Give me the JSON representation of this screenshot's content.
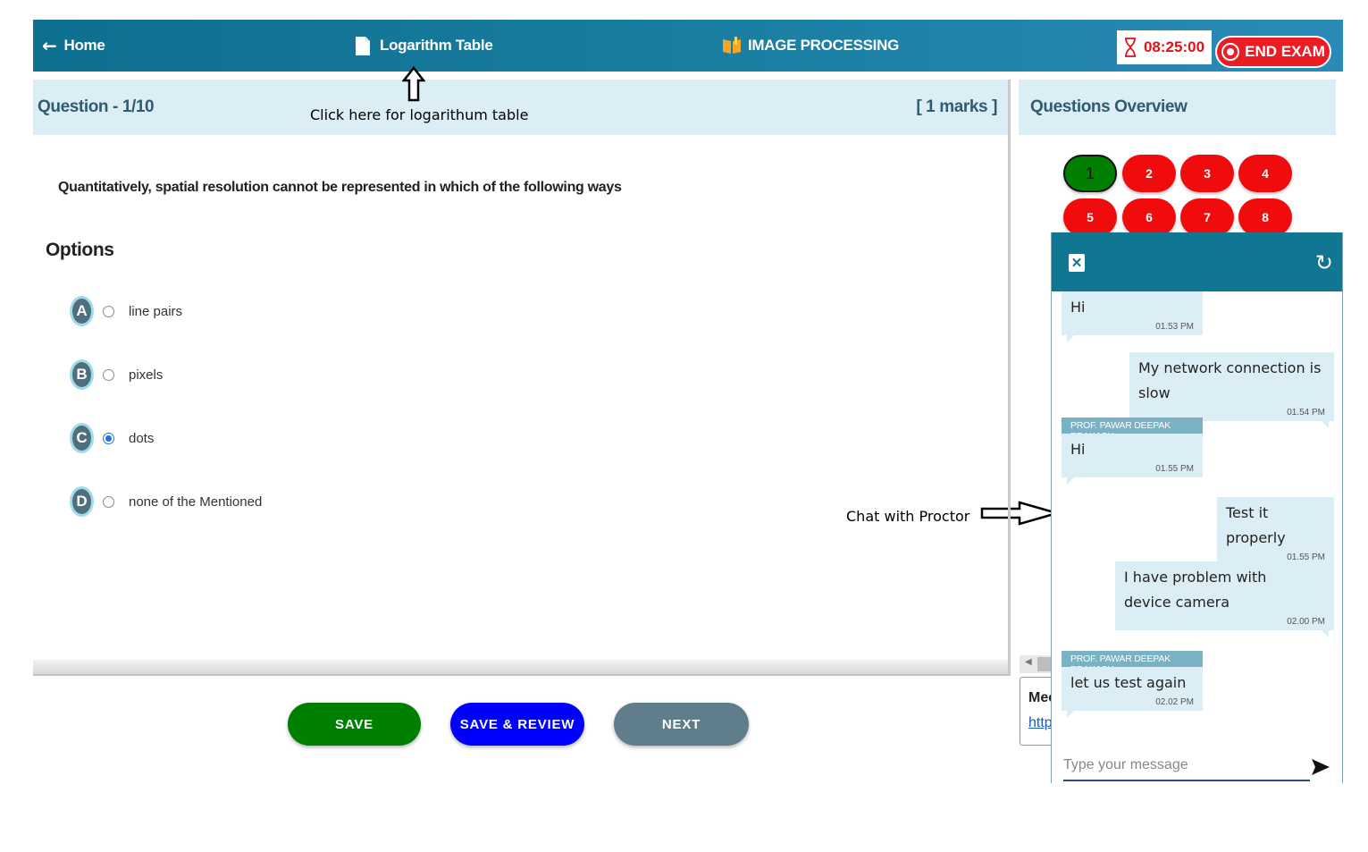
{
  "topbar": {
    "home_label": "Home",
    "log_table_label": "Logarithm Table",
    "subject_label": "IMAGE PROCESSING",
    "timer": "08:25:00",
    "end_exam_label": "END EXAM"
  },
  "question": {
    "title": "Question - 1/10",
    "marks": "[ 1 marks ]",
    "text": "Quantitatively, spatial resolution cannot be represented in which of the following ways",
    "options_heading": "Options",
    "options": [
      {
        "letter": "A",
        "label": "line pairs",
        "selected": false
      },
      {
        "letter": "B",
        "label": "pixels",
        "selected": false
      },
      {
        "letter": "C",
        "label": "dots",
        "selected": true
      },
      {
        "letter": "D",
        "label": "none of the Mentioned",
        "selected": false
      }
    ]
  },
  "annotations": {
    "log_table_hint": "Click here for logarithum table",
    "chat_hint": "Chat with Proctor"
  },
  "actions": {
    "save": "SAVE",
    "save_review": "SAVE & REVIEW",
    "next": "NEXT"
  },
  "overview": {
    "title": "Questions Overview",
    "numbers": [
      "1",
      "2",
      "3",
      "4",
      "5",
      "6",
      "7",
      "8"
    ],
    "current": "1"
  },
  "meet": {
    "label": "Mee",
    "link": "http"
  },
  "chat": {
    "messages": [
      {
        "dir": "in",
        "sender": "",
        "text": "Hi",
        "time": "01.53 PM"
      },
      {
        "dir": "out",
        "sender": "",
        "text": "My network connection is slow",
        "time": "01.54 PM"
      },
      {
        "dir": "in",
        "sender": "PROF. PAWAR DEEPAK PRAKASH",
        "text": "Hi",
        "time": "01.55 PM"
      },
      {
        "dir": "out",
        "sender": "",
        "text": "Test it properly",
        "time": "01.55 PM"
      },
      {
        "dir": "out",
        "sender": "",
        "text": "I have problem with device camera",
        "time": "02.00 PM"
      },
      {
        "dir": "in",
        "sender": "PROF. PAWAR DEEPAK PRAKASH",
        "text": "let us test again",
        "time": "02.02 PM"
      }
    ],
    "input_placeholder": "Type your message"
  },
  "colors": {
    "topbar": "#1a7fa3",
    "save": "#008000",
    "save_review": "#0000ff",
    "next": "#607d8b",
    "end_exam": "#ea1c24",
    "qnum_unanswered": "#f00c0c",
    "qnum_current": "#008000"
  }
}
